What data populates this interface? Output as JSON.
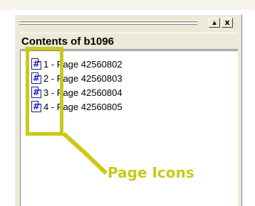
{
  "window": {
    "restore_glyph": "▴",
    "close_glyph": "x"
  },
  "header": {
    "title": "Contents of b1096"
  },
  "list": {
    "items": [
      {
        "number": "1",
        "label": "1 - Page 42560802"
      },
      {
        "number": "2",
        "label": "2 - Page 42560803"
      },
      {
        "number": "3",
        "label": "3 - Page 42560804"
      },
      {
        "number": "4",
        "label": "4 - Page 42560805"
      }
    ],
    "icon": "page-icon"
  },
  "annotation": {
    "label": "Page Icons",
    "color": "#c9c91a"
  },
  "colors": {
    "panel": "#ece9d8",
    "icon_glyph": "#2222c8"
  }
}
